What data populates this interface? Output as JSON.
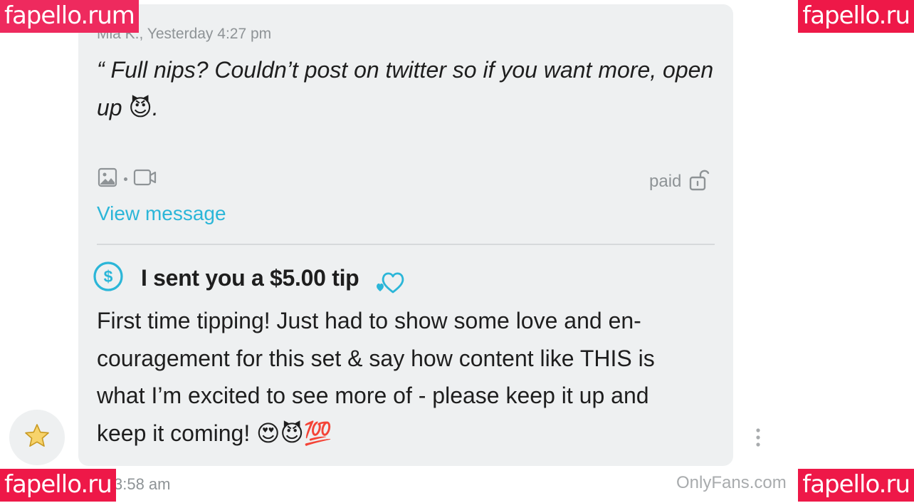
{
  "message": {
    "sender_line": "Mia K., Yesterday 4:27 pm",
    "quote_text": "“ Full nips? Couldn’t post on twitter so if you want more, open up",
    "quote_emoji": "😈",
    "quote_end": ".",
    "paid_label": "paid",
    "view_message_label": "View message"
  },
  "tip": {
    "title": "I sent you a $5.00 tip",
    "body_lines": [
      "First time tipping! Just had to show some love and en-",
      "couragement for this set & say how content like THIS is",
      "what I’m excited to see more of - please keep it up and",
      "keep it coming!"
    ],
    "body_emojis": "😍😈💯"
  },
  "footer": {
    "time": "3:58 am",
    "site_watermark": "OnlyFans.com"
  },
  "watermarks": {
    "top_left": "fapello.rum",
    "top_right": "fapello.ru",
    "bottom_left": "fapello.ru",
    "bottom_right": "fapello.ru"
  },
  "colors": {
    "accent": "#2bb6d8",
    "card_bg": "#eef0f1",
    "muted_text": "#8e9396",
    "watermark_bg": "#ee1848"
  },
  "icons": {
    "media": [
      "image-icon",
      "video-icon"
    ],
    "paid": "unlock-icon",
    "tip": "dollar-circle-icon",
    "heart": "hearts-icon",
    "favorite": "star-icon",
    "more": "more-vertical-icon"
  }
}
